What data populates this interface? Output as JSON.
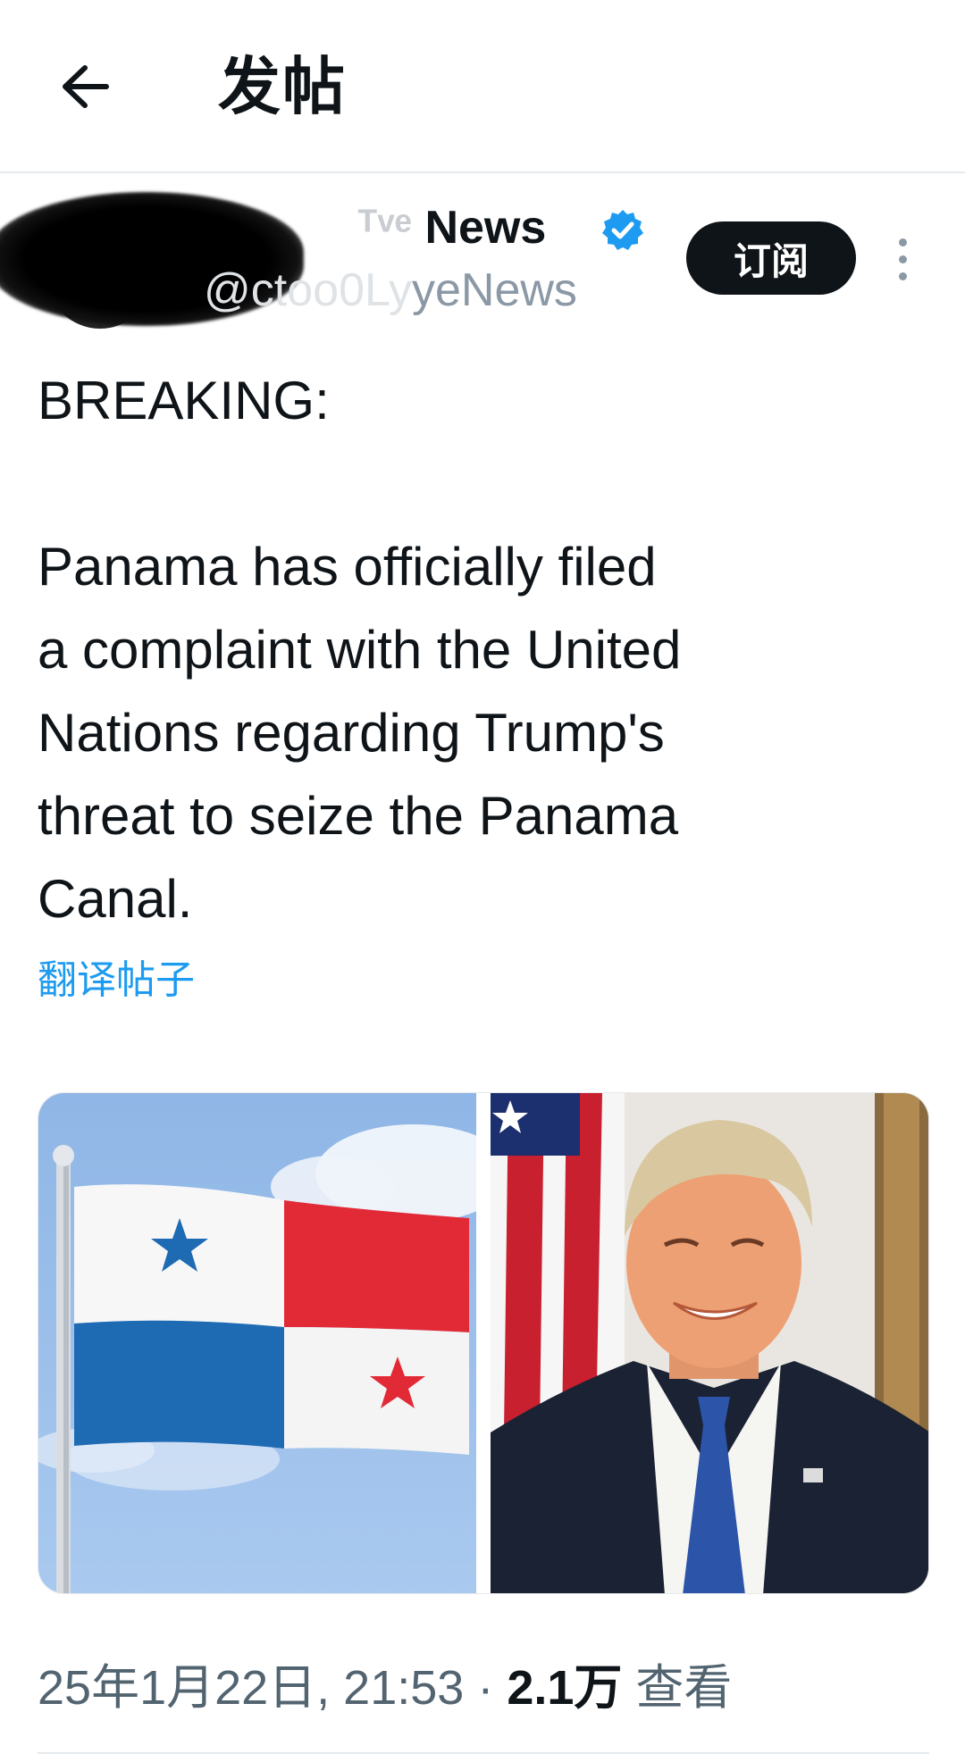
{
  "header": {
    "title": "发帖",
    "back_icon": "arrow-left-icon"
  },
  "author": {
    "display_name_visible": "News",
    "display_name_faded": "ᵀᵛᵉ ",
    "handle_visible": "yeNews",
    "handle_faded": "@ctoo0Ly",
    "verified": true,
    "verified_color": "#1d9bf0",
    "subscribe_label": "订阅",
    "more_icon": "more-vertical-icon"
  },
  "post": {
    "text": "BREAKING:\n\nPanama has officially filed\na complaint with the United\nNations regarding Trump's\nthreat to seize the Panama\nCanal.",
    "translate_label": "翻译帖子"
  },
  "media": [
    {
      "kind": "photo",
      "subject": "Panama flag"
    },
    {
      "kind": "photo",
      "subject": "portrait with US flag"
    }
  ],
  "meta": {
    "timestamp": "25年1月22日, 21:53",
    "separator": " · ",
    "views_count": "2.1万",
    "views_label": " 查看"
  },
  "colors": {
    "accent": "#1d9bf0",
    "text_primary": "#0f1419",
    "text_secondary": "#536471",
    "divider": "#e6e9ec"
  }
}
